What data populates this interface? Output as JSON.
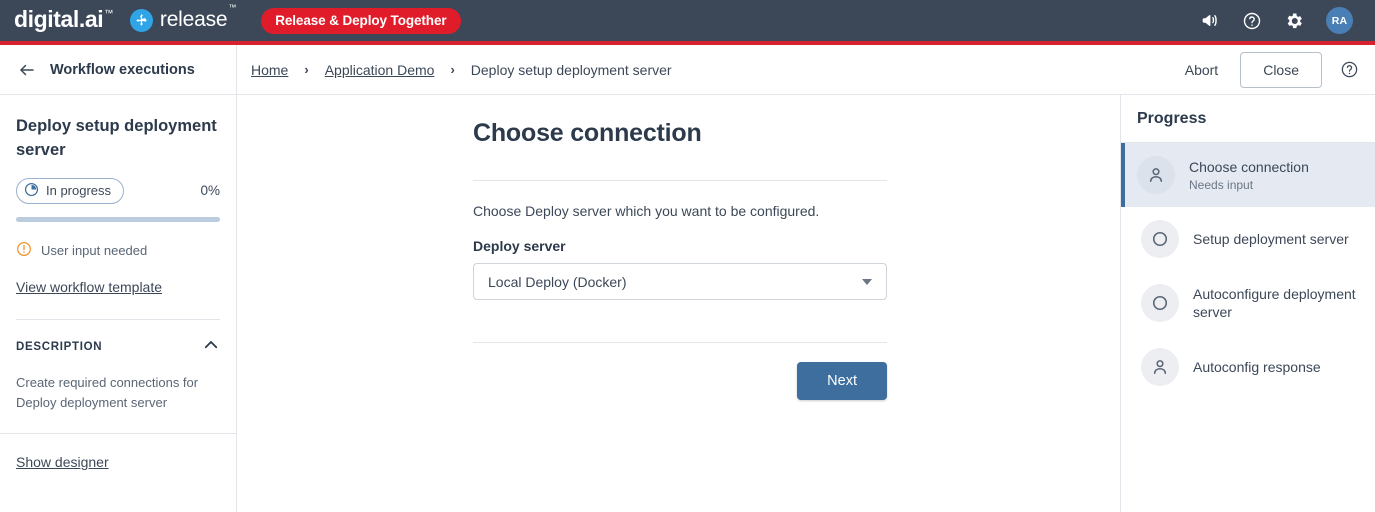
{
  "topbar": {
    "brand": "digital.ai",
    "brand_tm": "™",
    "product": "release",
    "product_tm": "™",
    "pill": "Release & Deploy Together",
    "icons": [
      "announcement-icon",
      "help-icon",
      "gear-icon"
    ],
    "avatar_initials": "RA",
    "colors": {
      "header_bg": "#3c4858",
      "red_stripe": "#d9222f",
      "pill_bg": "#e01c2b",
      "avatar_bg": "#4a7fb5",
      "release_badge_bg": "#2fa4e7"
    }
  },
  "subheader": {
    "back_label": "back-arrow",
    "workflow_executions": "Workflow executions",
    "breadcrumb": [
      {
        "label": "Home",
        "link": true
      },
      {
        "label": "Application Demo",
        "link": true
      },
      {
        "label": "Deploy setup deployment server",
        "link": false
      }
    ],
    "separator": "›",
    "abort_label": "Abort",
    "close_label": "Close"
  },
  "sidebar": {
    "title": "Deploy setup deployment server",
    "status_label": "In progress",
    "percent": "0%",
    "progress_value": 0,
    "user_input": "User input needed",
    "view_template": "View workflow template",
    "description_heading": "DESCRIPTION",
    "description_text": "Create required connections for Deploy deployment server",
    "show_designer": "Show designer"
  },
  "main": {
    "title": "Choose connection",
    "lead": "Choose Deploy server which you want to be configured.",
    "field_label": "Deploy server",
    "select_value": "Local Deploy (Docker)",
    "next_label": "Next"
  },
  "progress_panel": {
    "heading": "Progress",
    "steps": [
      {
        "title": "Choose connection",
        "sub": "Needs input",
        "icon": "person-icon",
        "active": true
      },
      {
        "title": "Setup deployment server",
        "sub": "",
        "icon": "circle-icon",
        "active": false
      },
      {
        "title": "Autoconfigure deployment server",
        "sub": "",
        "icon": "circle-icon",
        "active": false
      },
      {
        "title": "Autoconfig response",
        "sub": "",
        "icon": "person-icon",
        "active": false
      }
    ]
  }
}
